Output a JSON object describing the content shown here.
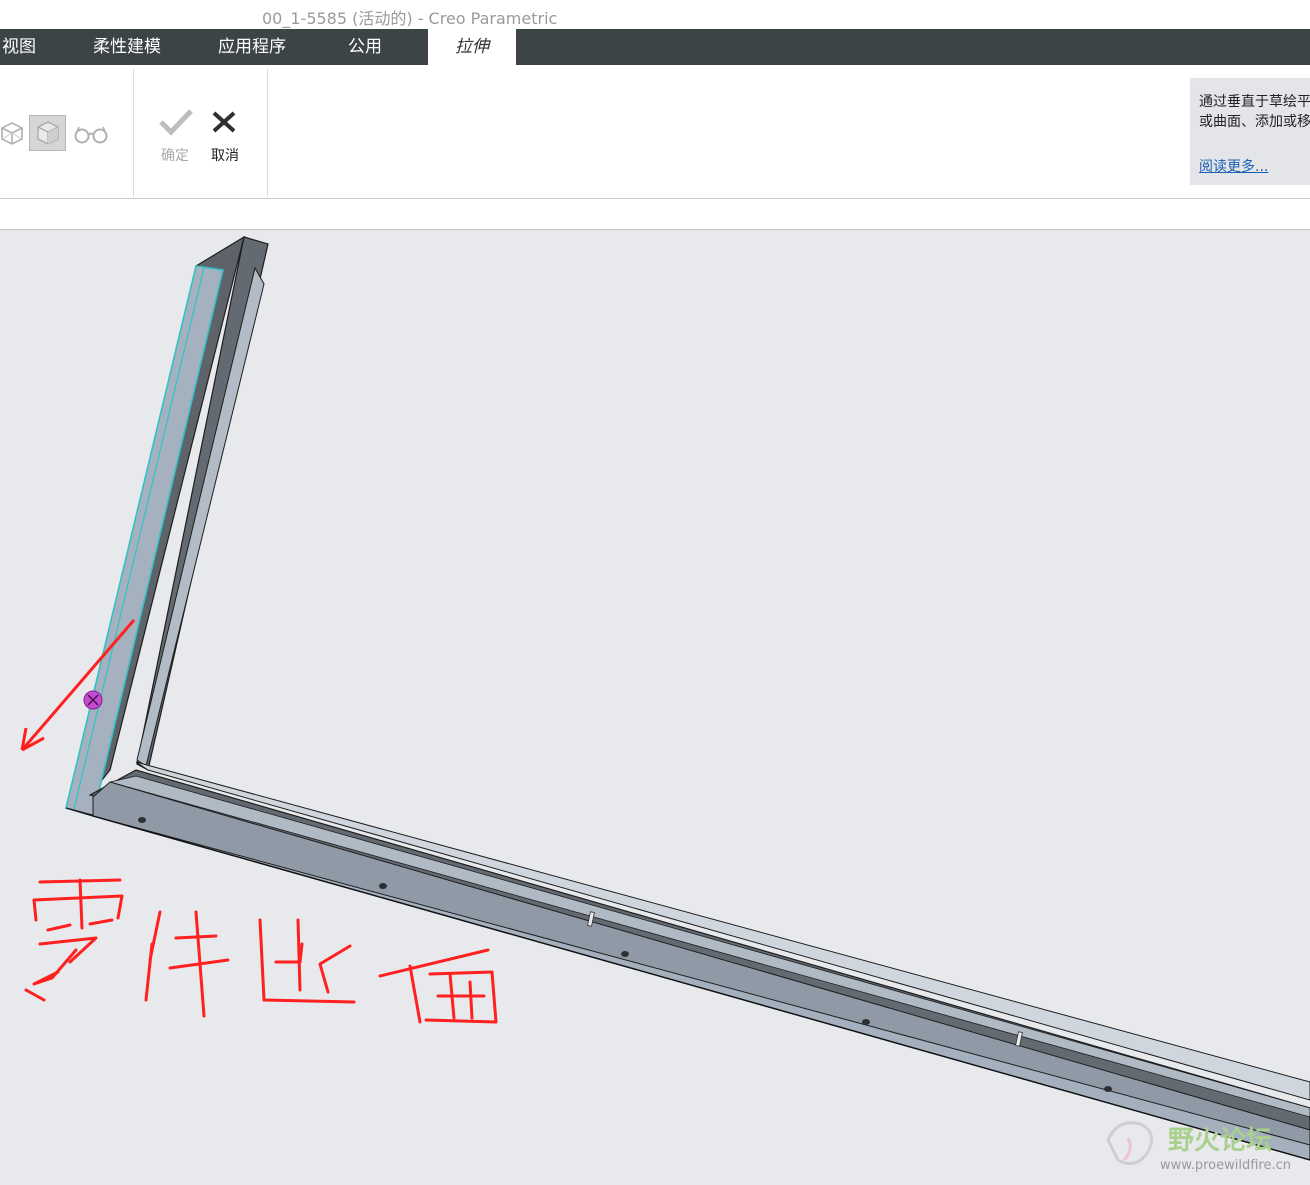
{
  "window": {
    "title": "00_1-5585 (活动的) - Creo Parametric"
  },
  "tabs": [
    {
      "label": "视图",
      "active": false
    },
    {
      "label": "柔性建模",
      "active": false
    },
    {
      "label": "应用程序",
      "active": false
    },
    {
      "label": "公用",
      "active": false
    },
    {
      "label": "拉伸",
      "active": true
    }
  ],
  "ribbon": {
    "view_icons": [
      "glasses-icon"
    ],
    "ok_label": "确定",
    "cancel_label": "取消"
  },
  "help": {
    "line1": "通过垂直于草绘平",
    "line2": "或曲面、添加或移",
    "link": "阅读更多..."
  },
  "annotation": {
    "handwriting": "零件此面",
    "color": "#ff2020"
  },
  "watermark": {
    "name": "野火论坛",
    "url": "www.proewildfire.cn"
  },
  "colors": {
    "tabbar": "#3d4446",
    "viewport_bg": "#e8e9ed",
    "part_face": "#a4b0bd",
    "part_dark": "#6b7077",
    "highlight_edge": "#31c2c6"
  }
}
